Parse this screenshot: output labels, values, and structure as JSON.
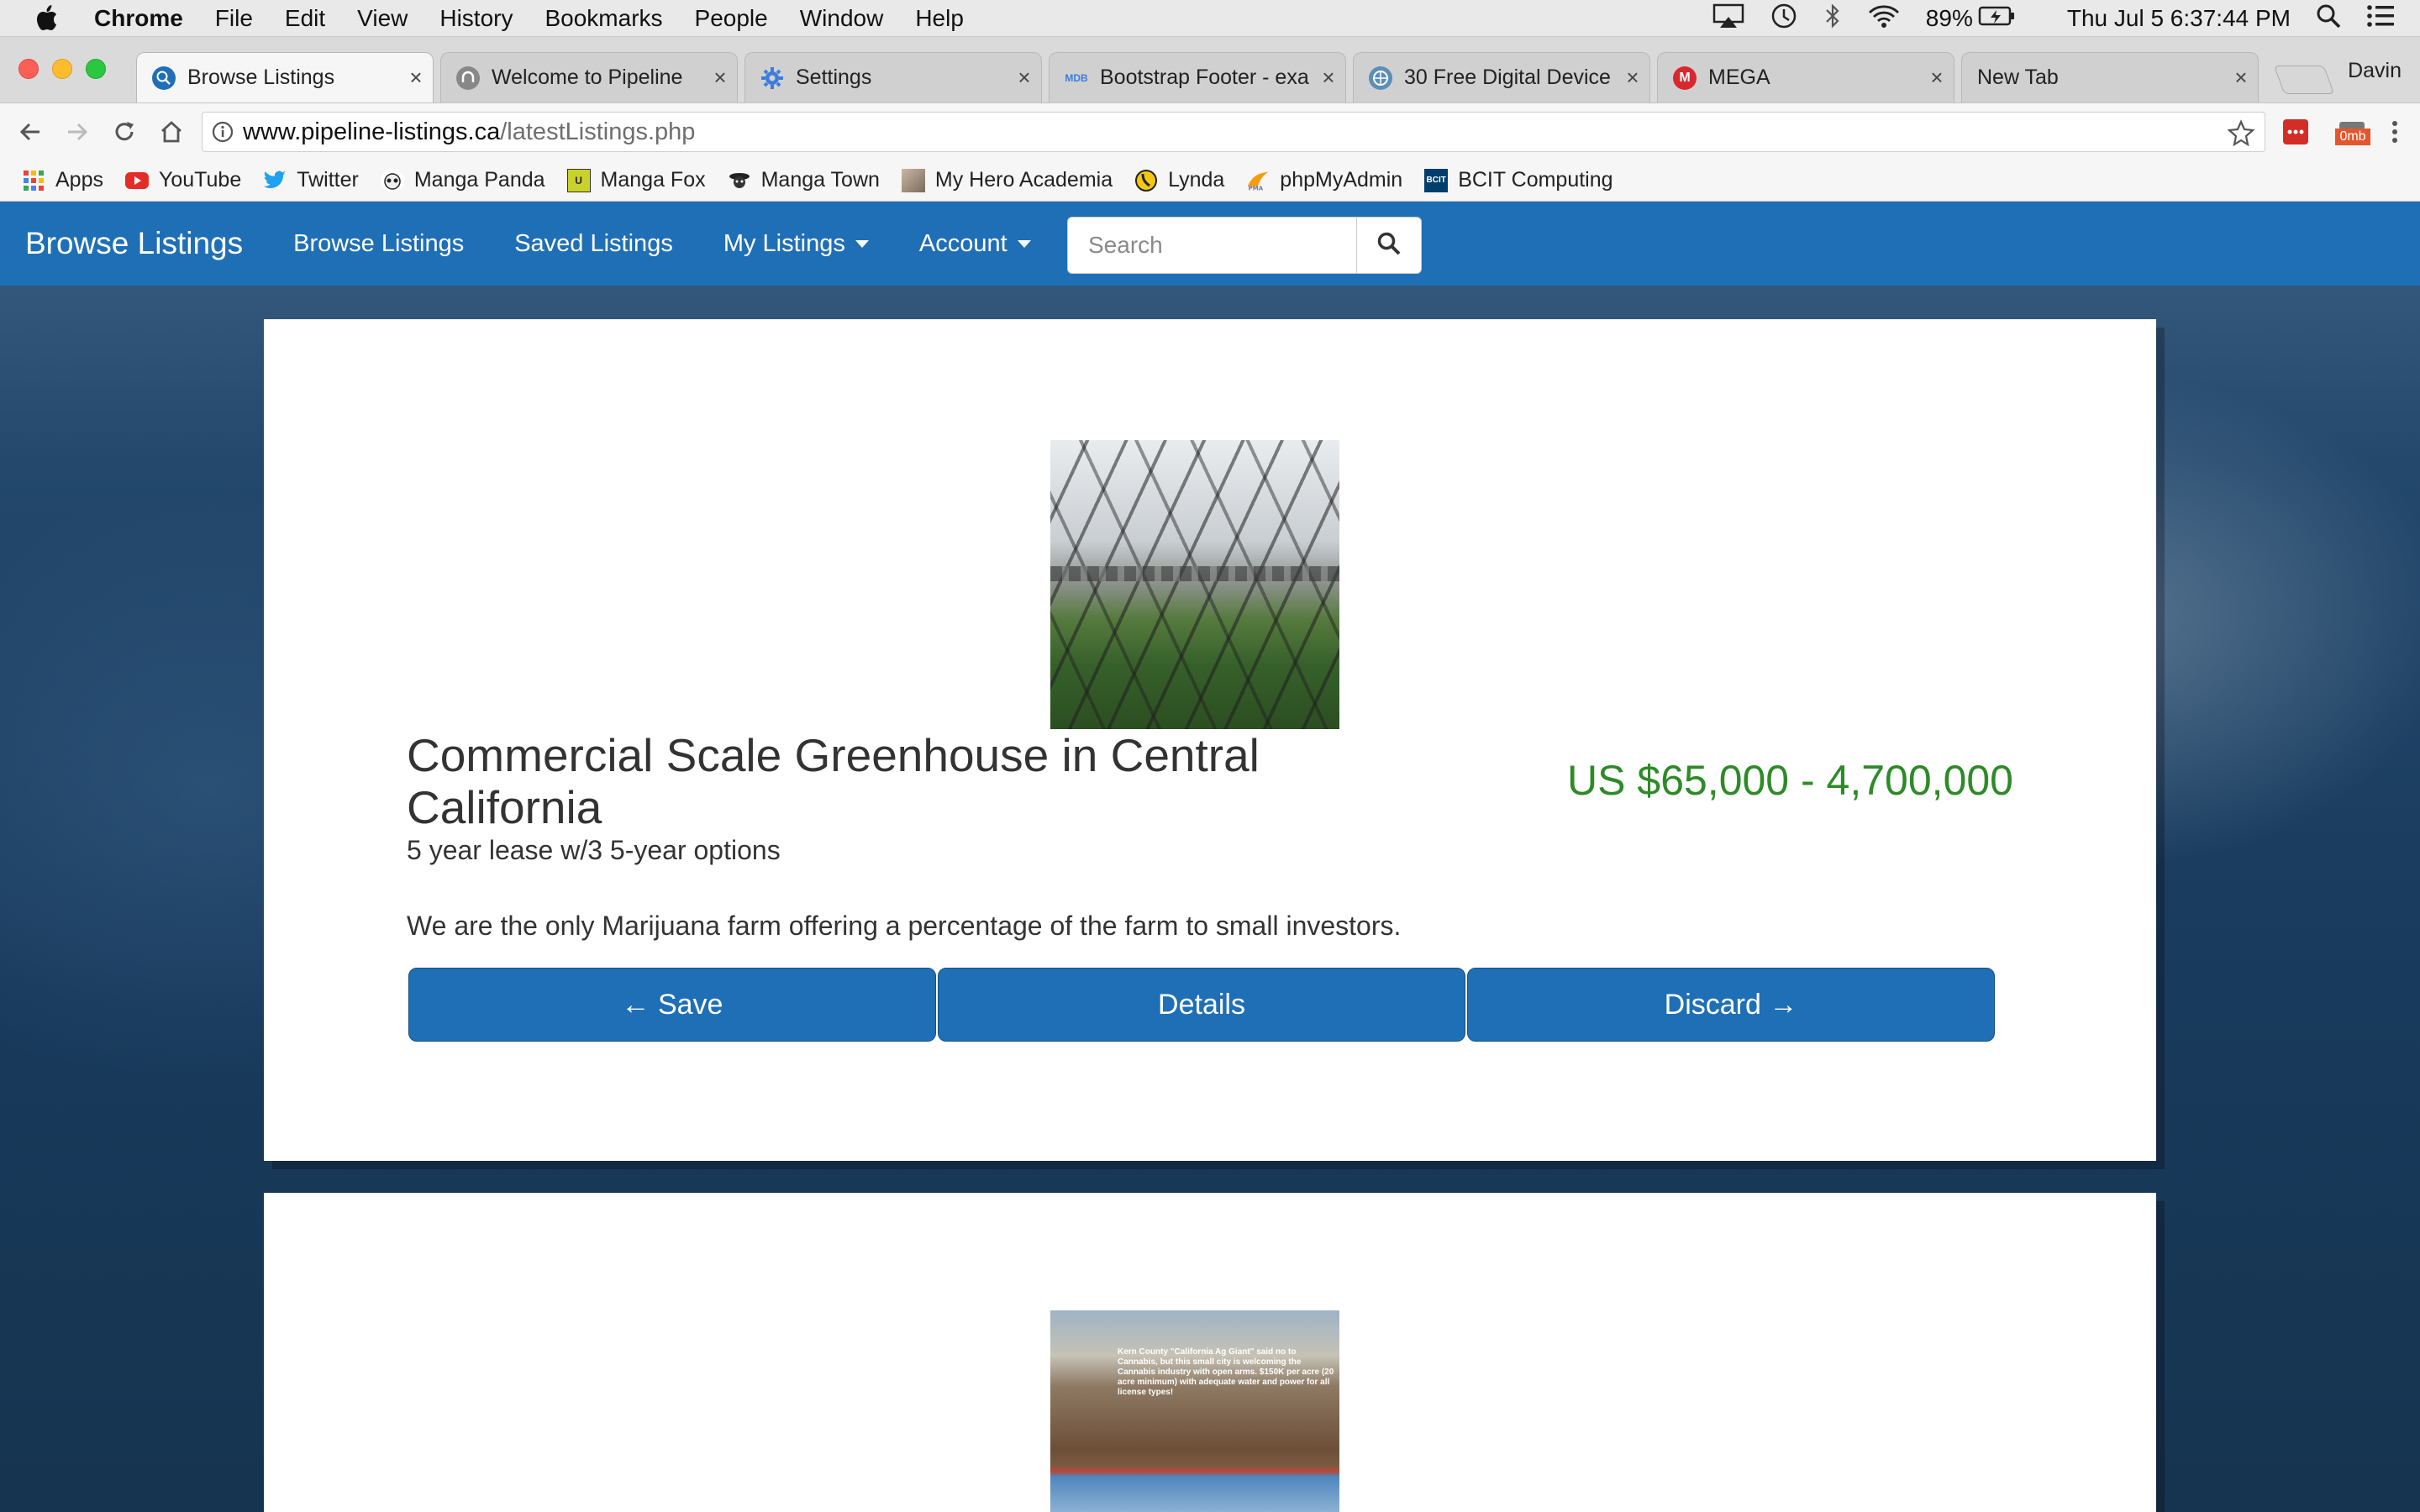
{
  "menubar": {
    "app": "Chrome",
    "items": [
      "File",
      "Edit",
      "View",
      "History",
      "Bookmarks",
      "People",
      "Window",
      "Help"
    ],
    "battery": "89%",
    "clock": "Thu Jul 5  6:37:44 PM"
  },
  "tabs": [
    {
      "title": "Browse Listings",
      "icon": "search-globe-icon",
      "active": true
    },
    {
      "title": "Welcome to Pipeline",
      "icon": "pipeline-icon",
      "active": false
    },
    {
      "title": "Settings",
      "icon": "gear-icon",
      "active": false
    },
    {
      "title": "Bootstrap Footer - exa",
      "icon": "mdb-icon",
      "active": false
    },
    {
      "title": "30 Free Digital Device",
      "icon": "globe-icon",
      "active": false
    },
    {
      "title": "MEGA",
      "icon": "mega-icon",
      "active": false
    },
    {
      "title": "New Tab",
      "icon": "none",
      "active": false
    }
  ],
  "profile": "Davin",
  "address": {
    "host": "www.pipeline-listings.ca",
    "path": "/latestListings.php"
  },
  "bookmarks": [
    {
      "label": "Apps",
      "icon": "apps-grid-icon"
    },
    {
      "label": "YouTube",
      "icon": "youtube-icon"
    },
    {
      "label": "Twitter",
      "icon": "twitter-icon"
    },
    {
      "label": "Manga Panda",
      "icon": "manga-panda-icon"
    },
    {
      "label": "Manga Fox",
      "icon": "manga-fox-icon"
    },
    {
      "label": "Manga Town",
      "icon": "manga-town-icon"
    },
    {
      "label": "My Hero Academia",
      "icon": "mha-icon"
    },
    {
      "label": "Lynda",
      "icon": "lynda-icon"
    },
    {
      "label": "phpMyAdmin",
      "icon": "phpmyadmin-icon"
    },
    {
      "label": "BCIT Computing",
      "icon": "bcit-icon"
    }
  ],
  "extension_badge": "0mb",
  "navbar": {
    "brand": "Browse Listings",
    "links": [
      "Browse Listings",
      "Saved Listings",
      "My Listings",
      "Account"
    ],
    "search_placeholder": "Search",
    "color": "#1f6fb6"
  },
  "listings": [
    {
      "title": "Commercial Scale Greenhouse in Central California",
      "subtitle": "5 year lease w/3 5-year options",
      "price": "US $65,000 - 4,700,000",
      "description": "We are the only Marijuana farm offering a percentage of the farm to small investors.",
      "buttons": {
        "save": "← Save",
        "details": "Details",
        "discard": "Discard →"
      },
      "price_color": "#2d8b27"
    },
    {
      "image_text": "Kern County \"California Ag Giant\" said no to Cannabis, but this small city is welcoming the Cannabis industry with open arms. $150K per acre (20 acre minimum) with adequate water and power for all license types!"
    }
  ]
}
